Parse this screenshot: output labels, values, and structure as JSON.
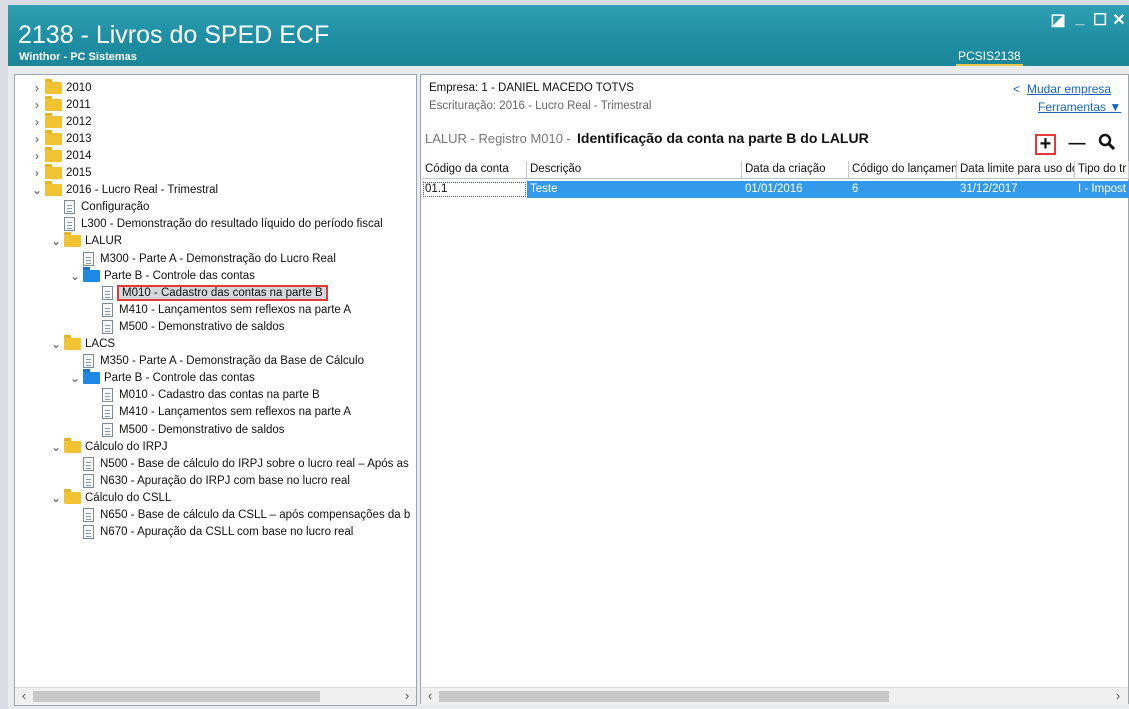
{
  "window": {
    "title": "2138 - Livros do SPED ECF",
    "subtitle": "Winthor - PC Sistemas",
    "code": "PCSIS2138"
  },
  "tree": [
    {
      "label": "2010",
      "kind": "folder-y",
      "expander": "›",
      "level": 0
    },
    {
      "label": "2011",
      "kind": "folder-y",
      "expander": "›",
      "level": 0
    },
    {
      "label": "2012",
      "kind": "folder-y",
      "expander": "›",
      "level": 0
    },
    {
      "label": "2013",
      "kind": "folder-y",
      "expander": "›",
      "level": 0
    },
    {
      "label": "2014",
      "kind": "folder-y",
      "expander": "›",
      "level": 0
    },
    {
      "label": "2015",
      "kind": "folder-y",
      "expander": "›",
      "level": 0
    },
    {
      "label": "2016 - Lucro Real - Trimestral",
      "kind": "folder-y",
      "expander": "⌄",
      "level": 0
    },
    {
      "label": "Configuração",
      "kind": "doc",
      "expander": "",
      "level": 1
    },
    {
      "label": "L300 - Demonstração do resultado líquido do período fiscal",
      "kind": "doc",
      "expander": "",
      "level": 1
    },
    {
      "label": "LALUR",
      "kind": "folder-y",
      "expander": "⌄",
      "level": 1
    },
    {
      "label": "M300 - Parte A - Demonstração do Lucro Real",
      "kind": "doc",
      "expander": "",
      "level": 2
    },
    {
      "label": "Parte B - Controle das contas",
      "kind": "folder-b",
      "expander": "⌄",
      "level": 2
    },
    {
      "label": "M010 - Cadastro das contas na parte B",
      "kind": "doc",
      "expander": "",
      "level": 3,
      "selected": true
    },
    {
      "label": "M410 - Lançamentos sem reflexos na parte A",
      "kind": "doc",
      "expander": "",
      "level": 3
    },
    {
      "label": "M500 - Demonstrativo de saldos",
      "kind": "doc",
      "expander": "",
      "level": 3
    },
    {
      "label": "LACS",
      "kind": "folder-y",
      "expander": "⌄",
      "level": 1
    },
    {
      "label": "M350 - Parte A - Demonstração da Base de Cálculo",
      "kind": "doc",
      "expander": "",
      "level": 2
    },
    {
      "label": "Parte B - Controle das contas",
      "kind": "folder-b",
      "expander": "⌄",
      "level": 2
    },
    {
      "label": "M010 - Cadastro das contas na parte B",
      "kind": "doc",
      "expander": "",
      "level": 3
    },
    {
      "label": "M410 - Lançamentos sem reflexos na parte A",
      "kind": "doc",
      "expander": "",
      "level": 3
    },
    {
      "label": "M500 - Demonstrativo de saldos",
      "kind": "doc",
      "expander": "",
      "level": 3
    },
    {
      "label": "Cálculo do IRPJ",
      "kind": "folder-y",
      "expander": "⌄",
      "level": 1
    },
    {
      "label": "N500 - Base de cálculo do IRPJ sobre o lucro real – Após as",
      "kind": "doc",
      "expander": "",
      "level": 2
    },
    {
      "label": "N630 - Apuração do IRPJ com base no lucro real",
      "kind": "doc",
      "expander": "",
      "level": 2
    },
    {
      "label": "Cálculo do CSLL",
      "kind": "folder-y",
      "expander": "⌄",
      "level": 1
    },
    {
      "label": "N650 - Base de cálculo da CSLL – após compensações da b",
      "kind": "doc",
      "expander": "",
      "level": 2
    },
    {
      "label": "N670 - Apuração da CSLL com base no lucro real",
      "kind": "doc",
      "expander": "",
      "level": 2
    }
  ],
  "header": {
    "empresa": "Empresa: 1 - DANIEL MACEDO TOTVS",
    "escrituracao": "Escrituração: 2016 - Lucro Real - Trimestral",
    "mudar_empresa": "Mudar empresa",
    "ferramentas": "Ferramentas ▼",
    "back_glyph": "<"
  },
  "section": {
    "prefix": "LALUR - Registro M010 -",
    "title": "Identificação da conta na parte B do LALUR"
  },
  "toolbar": {
    "add": "+",
    "remove": "—",
    "search": "🔍"
  },
  "grid": {
    "columns": [
      "Código da conta",
      "Descrição",
      "Data da criação",
      "Código do lançamento",
      "Data limite para uso do",
      "Tipo do tr"
    ],
    "rows": [
      [
        "01.1",
        "Teste",
        "01/01/2016",
        "6",
        "31/12/2017",
        "I - Impost"
      ]
    ]
  },
  "colors": {
    "accent": "#1f8ea3",
    "selection": "#3399ea",
    "highlight": "#e53935"
  }
}
